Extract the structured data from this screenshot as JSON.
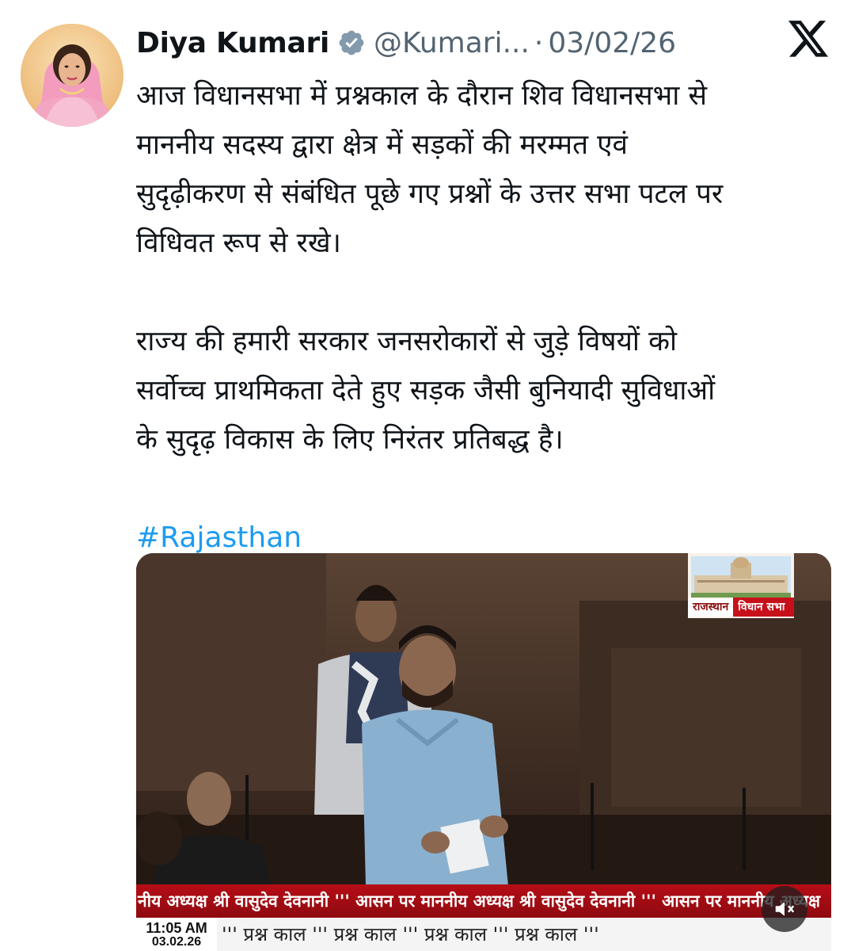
{
  "author": {
    "name": "Diya Kumari",
    "handle": "@Kumari...",
    "separator": "·",
    "date": "03/02/26",
    "avatar_icon": "profile-photo",
    "verified_icon": "verified-badge-icon"
  },
  "platform_icon": "x-logo-icon",
  "text_lines": [
    "आज विधानसभा में प्रश्नकाल के दौरान शिव विधानसभा से",
    "माननीय सदस्य द्वारा क्षेत्र में सड़कों की मरम्मत एवं",
    "सुदृढ़ीकरण से संबंधित पूछे गए प्रश्नों के उत्तर सभा पटल पर",
    "विधिवत रूप से रखे।",
    "",
    "राज्य की हमारी सरकार जनसरोकारों से जुड़े विषयों को",
    "सर्वोच्च प्राथमिकता देते हुए सड़क जैसी बुनियादी सुविधाओं",
    "के सुदृढ़ विकास के लिए निरंतर प्रतिबद्ध है।"
  ],
  "hashtag": "#Rajasthan",
  "media": {
    "channel_logo": {
      "label_left": "राजस्थान",
      "label_right": "विधान सभा"
    },
    "ticker_text": "नीय अध्यक्ष श्री वासुदेव देवनानी ''' आसन पर माननीय अध्यक्ष श्री वासुदेव देवनानी ''' आसन पर माननीय अध्यक्ष",
    "clock_time": "11:05 AM",
    "clock_date": "03.02.26",
    "crawl_text": "''' प्रश्न काल ''' प्रश्न काल ''' प्रश्न काल ''' प्रश्न काल '''",
    "sound_icon": "speaker-muted-icon"
  },
  "colors": {
    "text": "#0f1419",
    "secondary": "#536471",
    "link": "#1d9bf0",
    "verified": "#829aab",
    "ticker_red": "#b60d16"
  }
}
